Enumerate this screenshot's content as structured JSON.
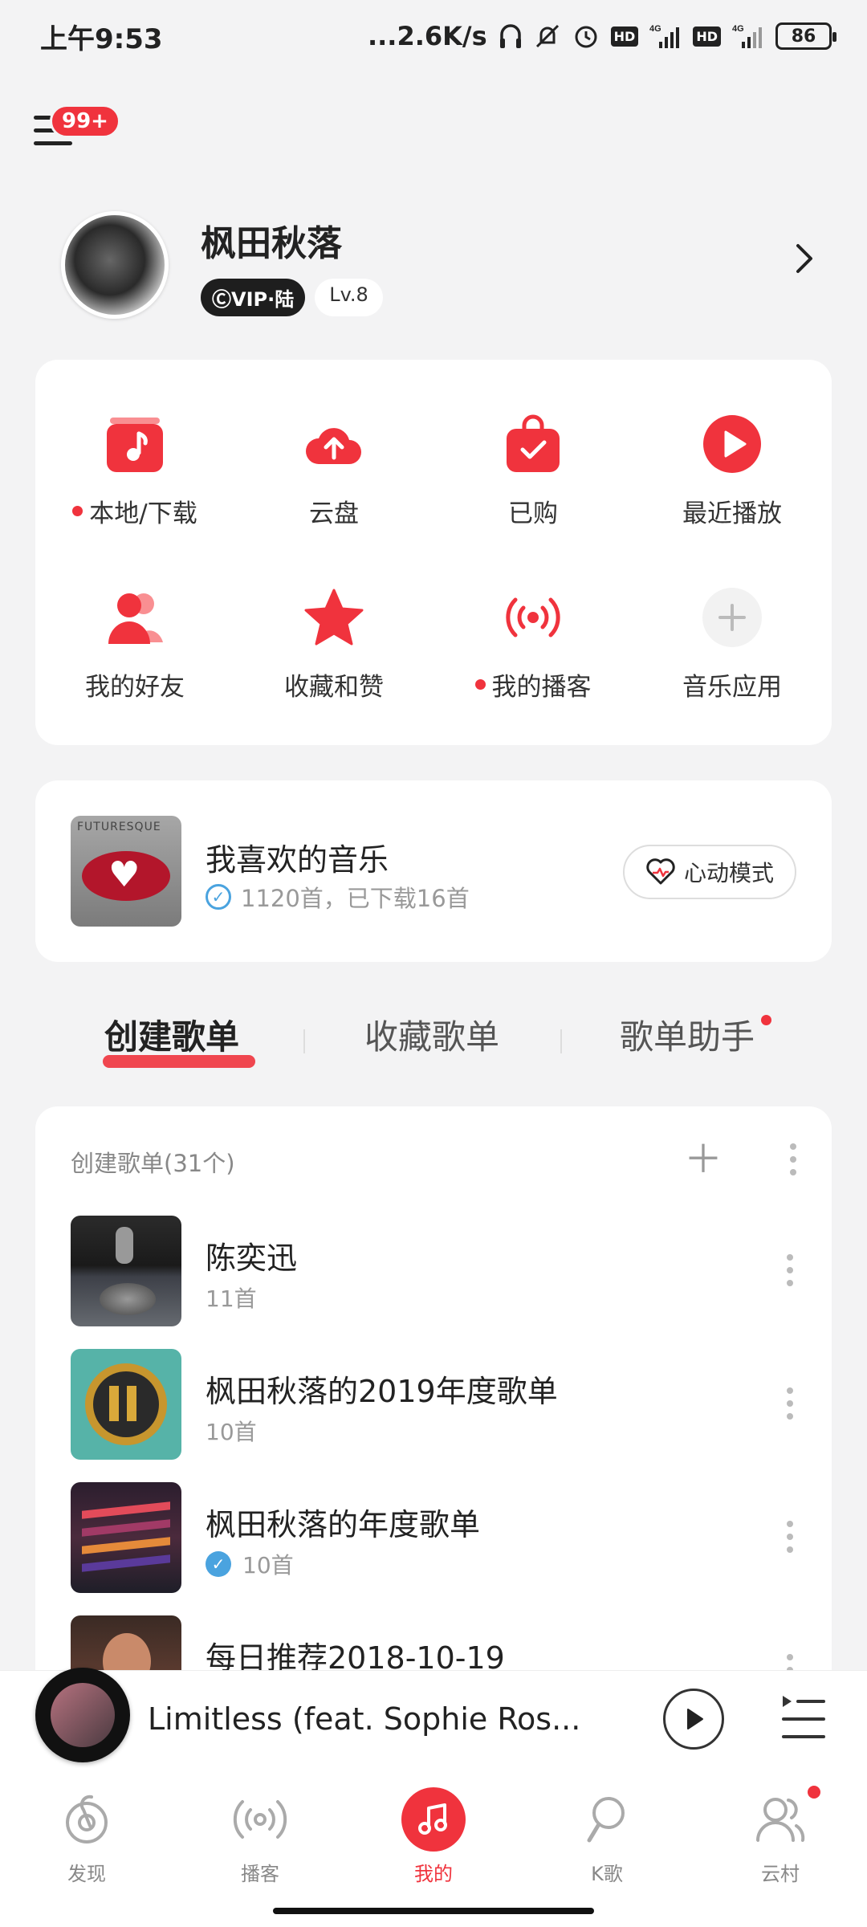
{
  "status_bar": {
    "time": "上午9:53",
    "network_speed": "...2.6K/s",
    "battery": "86",
    "icons": [
      "headphones-icon",
      "mute-icon",
      "alarm-icon",
      "hd-icon",
      "signal-4g-icon",
      "hd-icon",
      "signal-4g-icon"
    ]
  },
  "header": {
    "menu_badge": "99+"
  },
  "profile": {
    "name": "枫田秋落",
    "vip": "ⒸVIP·陆",
    "level": "Lv.8"
  },
  "grid": {
    "items": [
      {
        "label": "本地/下载",
        "icon": "music-folder-icon",
        "dot": true
      },
      {
        "label": "云盘",
        "icon": "cloud-upload-icon",
        "dot": false
      },
      {
        "label": "已购",
        "icon": "shopping-bag-icon",
        "dot": false
      },
      {
        "label": "最近播放",
        "icon": "play-circle-icon",
        "dot": false
      },
      {
        "label": "我的好友",
        "icon": "friends-icon",
        "dot": false
      },
      {
        "label": "收藏和赞",
        "icon": "star-icon",
        "dot": false
      },
      {
        "label": "我的播客",
        "icon": "podcast-icon",
        "dot": true
      },
      {
        "label": "音乐应用",
        "icon": "plus-icon",
        "dot": false
      }
    ]
  },
  "liked": {
    "title": "我喜欢的音乐",
    "subtitle": "1120首，已下载16首",
    "cover_text": "FUTURESQUE",
    "heart_mode": "心动模式"
  },
  "tabs": {
    "items": [
      "创建歌单",
      "收藏歌单",
      "歌单助手"
    ],
    "active": 0
  },
  "playlists": {
    "header": "创建歌单(31个)",
    "items": [
      {
        "title": "陈奕迅",
        "count": "11首",
        "verified": false
      },
      {
        "title": "枫田秋落的2019年度歌单",
        "count": "10首",
        "verified": false
      },
      {
        "title": "枫田秋落的年度歌单",
        "count": "10首",
        "verified": true
      },
      {
        "title": "每日推荐2018-10-19",
        "count": "",
        "verified": false
      }
    ]
  },
  "mini_player": {
    "title": "Limitless (feat. Sophie Ros..."
  },
  "bottom_nav": {
    "items": [
      {
        "label": "发现",
        "icon": "discover-icon"
      },
      {
        "label": "播客",
        "icon": "podcast-icon"
      },
      {
        "label": "我的",
        "icon": "music-note-icon"
      },
      {
        "label": "K歌",
        "icon": "microphone-icon"
      },
      {
        "label": "云村",
        "icon": "community-icon"
      }
    ],
    "active": 2
  },
  "colors": {
    "accent": "#f0333d",
    "background": "#f3f3f4"
  }
}
